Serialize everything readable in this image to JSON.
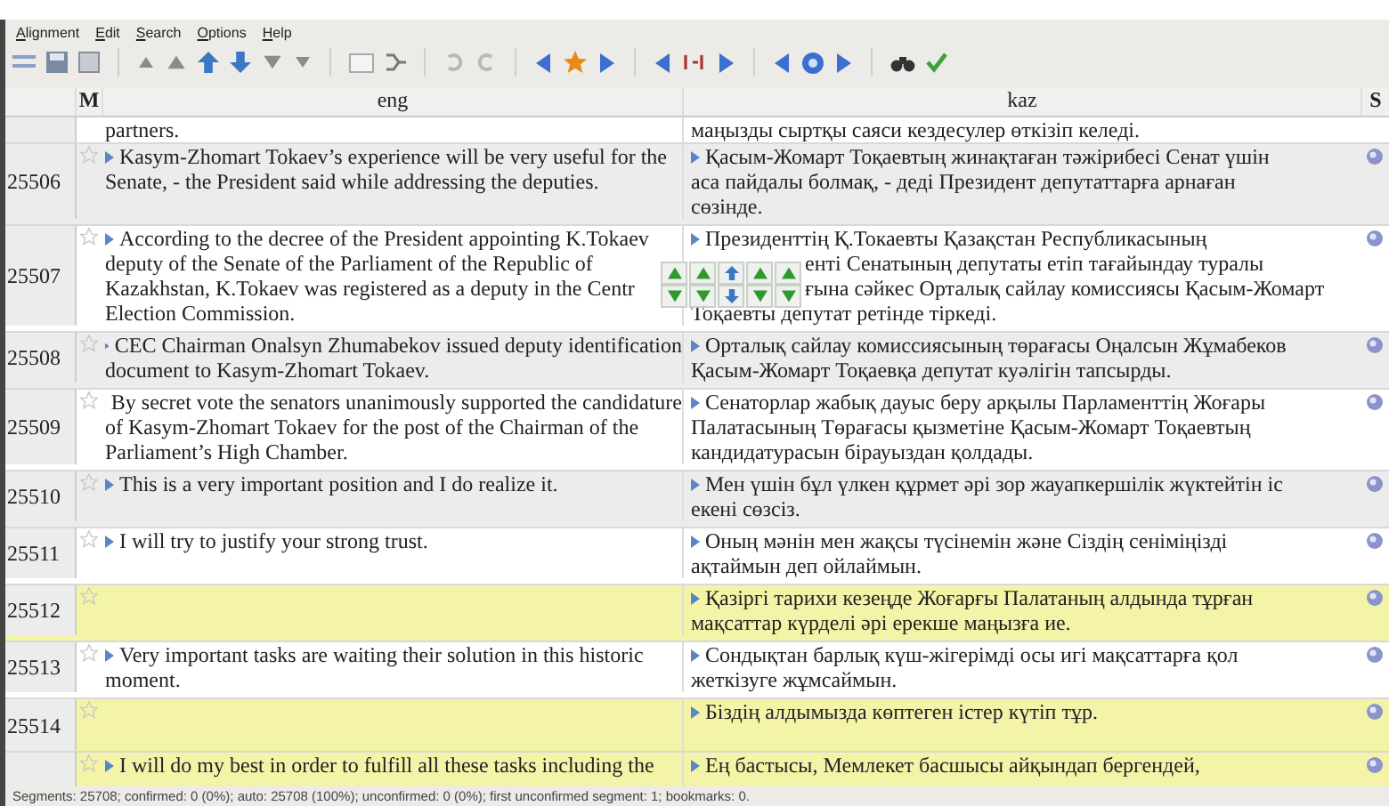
{
  "menu": [
    {
      "label": "Alignment"
    },
    {
      "label": "Edit"
    },
    {
      "label": "Search"
    },
    {
      "label": "Options"
    },
    {
      "label": "Help"
    }
  ],
  "columns": {
    "mark": "M",
    "source": "eng",
    "target": "kaz",
    "status": "S"
  },
  "rows": [
    {
      "continued": true,
      "highlighted": false,
      "eng": [
        "partners."
      ],
      "kaz": [
        "маңызды сыртқы саяси кездесулер өткізіп келеді."
      ]
    },
    {
      "id": "25506",
      "continued": false,
      "highlighted": false,
      "eng": [
        "Kasym-Zhomart Tokaev’s experience will be very useful for the",
        "Senate, - the President said while addressing the deputies."
      ],
      "kaz": [
        "Қасым-Жомарт Тоқаевтың жинақтаған тәжірибесі Сенат үшін",
        "аса пайдалы болмақ, - деді Президент депутаттарға арнаған",
        "сөзінде."
      ]
    },
    {
      "id": "25507",
      "continued": false,
      "highlighted": false,
      "eng": [
        "According to the decree of the President appointing K.Tokaev",
        "deputy of the Senate of the Parliament of the Republic of",
        "Kazakhstan, K.Tokaev was registered as a deputy in the Centr",
        "Election Commission."
      ],
      "kaz": [
        "Президенттің Қ.Токаевты Қазақстан Республикасының",
        "енті Сенатының депутаты етіп тағайындау туралы",
        "ғына сәйкес Орталық сайлау комиссиясы Қасым-Жомарт",
        "Тоқаевты депутат ретінде тіркеді."
      ],
      "popup": true
    },
    {
      "id": "25508",
      "continued": false,
      "highlighted": false,
      "eng": [
        "CEC Chairman Onalsyn Zhumabekov issued deputy identification",
        "document to Kasym-Zhomart Tokaev."
      ],
      "kaz": [
        "Орталық сайлау комиссиясының төрағасы Оңалсын Жұмабеков",
        "Қасым-Жомарт Тоқаевқа депутат куәлігін тапсырды."
      ]
    },
    {
      "id": "25509",
      "continued": false,
      "highlighted": false,
      "eng": [
        "By secret vote the senators unanimously supported the candidature",
        "of Kasym-Zhomart Tokaev for the post of the Chairman of the",
        "Parliament’s High Chamber."
      ],
      "kaz": [
        "Сенаторлар жабық дауыс беру арқылы Парламенттің Жоғары",
        "Палатасының Төрағасы қызметіне Қасым-Жомарт Тоқаевтың",
        "кандидатурасын бірауыздан қолдады."
      ]
    },
    {
      "id": "25510",
      "continued": false,
      "highlighted": false,
      "eng": [
        "This is a very important position and I do realize it."
      ],
      "kaz": [
        "Мен үшін бұл үлкен құрмет әрі зор жауапкершілік жүктейтін іс",
        "екені сөзсіз."
      ]
    },
    {
      "id": "25511",
      "continued": false,
      "highlighted": false,
      "eng": [
        "I will try to justify your strong trust."
      ],
      "kaz": [
        "Оның мәнін мен жақсы түсінемін және Сіздің сеніміңізді",
        "ақтаймын деп ойлаймын."
      ]
    },
    {
      "id": "25512",
      "continued": false,
      "highlighted": true,
      "eng": [],
      "kaz": [
        "Қазіргі тарихи кезеңде Жоғарғы Палатаның алдында тұрған",
        "мақсаттар күрделі әрі ерекше маңызға ие."
      ]
    },
    {
      "id": "25513",
      "continued": false,
      "highlighted": false,
      "eng": [
        "Very important tasks are waiting their solution in this historic",
        "moment."
      ],
      "kaz": [
        "Сондықтан барлық күш-жігерімді осы игі мақсаттарға қол",
        "жеткізуге жұмсаймын."
      ]
    },
    {
      "id": "25514",
      "continued": false,
      "highlighted": true,
      "eng": [],
      "kaz": [
        "Біздің алдымызда көптеген істер күтіп тұр."
      ]
    },
    {
      "continued": false,
      "highlighted": true,
      "eng": [
        "I will do my best in order to fulfill all these tasks including the"
      ],
      "kaz": [
        "Ең бастысы, Мемлекет басшысы айқындап бергендей,"
      ]
    }
  ],
  "status_bar": "Segments: 25708; confirmed: 0 (0%); auto: 25708 (100%); unconfirmed: 0 (0%); first unconfirmed segment: 1; bookmarks: 0."
}
